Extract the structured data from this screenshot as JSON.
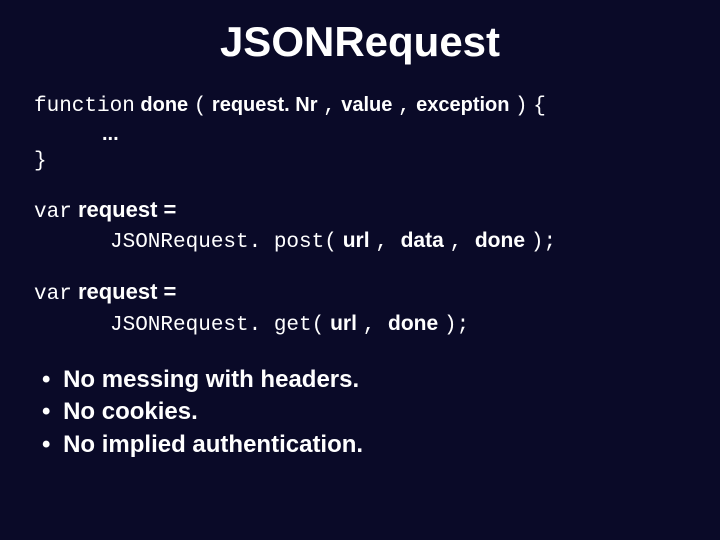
{
  "title": "JSONRequest",
  "code_fn": {
    "kw_function": "function",
    "name": "done",
    "open": "(",
    "p1": "request. Nr",
    "c1": ",",
    "p2": "value",
    "c2": ",",
    "p3": "exception",
    "close": ")",
    "brace_open": "{",
    "ellipsis": "...",
    "brace_close": "}"
  },
  "var1": {
    "kw_var": "var",
    "assign": "request =",
    "call_a": "JSONRequest. post(",
    "arg1": "url",
    "sep1": ", ",
    "arg2": "data",
    "sep2": ", ",
    "arg3": "done",
    "tail": ");"
  },
  "var2": {
    "kw_var": "var",
    "assign": "request =",
    "call_a": "JSONRequest. get(",
    "arg1": "url",
    "sep1": ", ",
    "arg2": "done",
    "tail": ");"
  },
  "bullets": [
    "No messing with headers.",
    "No cookies.",
    "No implied authentication."
  ]
}
